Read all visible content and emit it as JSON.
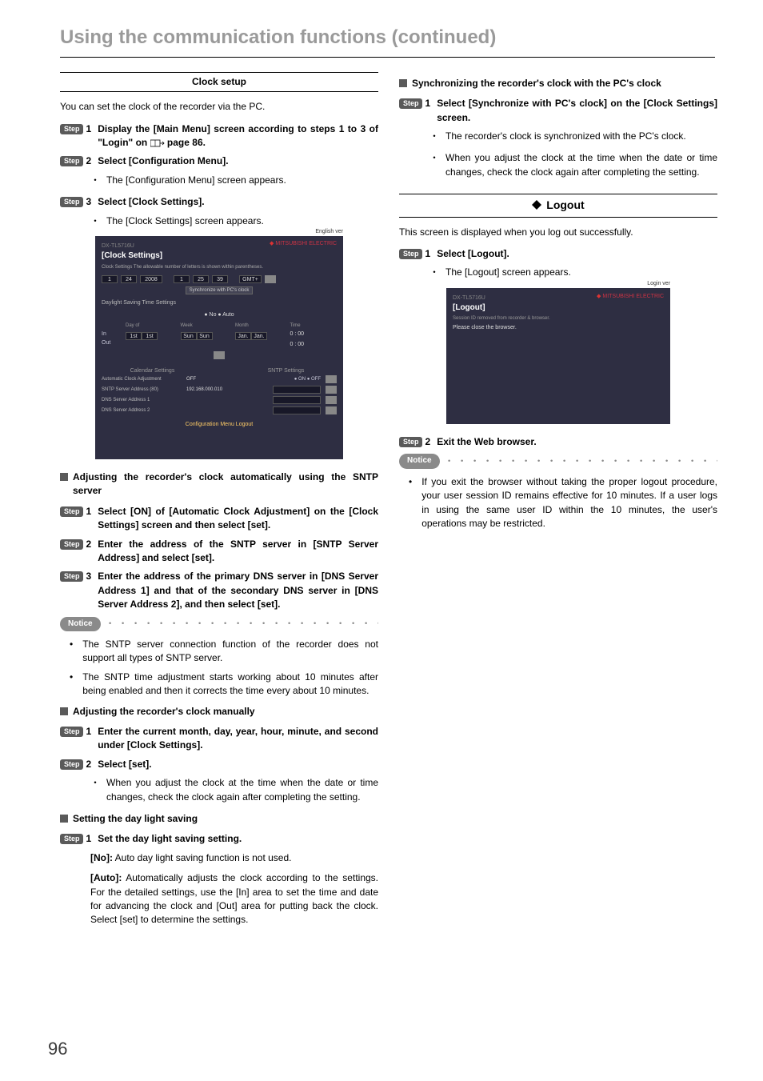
{
  "chapterTitle": "Using the communication functions (continued)",
  "left": {
    "sectionTitle": "Clock setup",
    "intro": "You can set the clock of the recorder via the PC.",
    "stepLabel": "Step",
    "step1": "Display the [Main Menu] screen according to steps 1 to 3 of \"Login\" on",
    "step1pageRef": "page 86.",
    "step2": "Select [Configuration Menu].",
    "step2sub": "The [Configuration Menu] screen appears.",
    "step3": "Select [Clock Settings].",
    "step3sub": "The [Clock Settings] screen appears.",
    "shot1": {
      "model": "DX-TL5716U",
      "english": "English ver",
      "title": "[Clock Settings]",
      "brand": "MITSUBISHI ELECTRIC",
      "noteline": "Clock Settings   The allowable number of letters is shown within parentheses.",
      "fields": {
        "month": "1",
        "day": "24",
        "year": "2008",
        "hour": "1",
        "min": "25",
        "sec": "39",
        "tz": "GMT+"
      },
      "syncBtn": "Synchronize with PC's clock",
      "dst": "Daylight Saving Time Settings",
      "radios": "● No ● Auto",
      "tbl": {
        "cols": [
          "Day of",
          "Week",
          "Month",
          "Time"
        ],
        "rows": [
          {
            "label": "In",
            "vals": [
              "1st",
              "Sun",
              "Jan.",
              "0 : 00"
            ]
          },
          {
            "label": "Out",
            "vals": [
              "1st",
              "Sun",
              "Jan.",
              "0 : 00"
            ]
          }
        ]
      },
      "calHead1": "Calendar Settings",
      "calHead2": "SNTP Settings",
      "rows": [
        {
          "l": "Automatic Clock Adjustment",
          "v": "OFF",
          "r": "● ON ● OFF"
        },
        {
          "l": "SNTP Server Address (80)",
          "v": "192.168.000.010",
          "r": ""
        },
        {
          "l": "DNS Server Address 1",
          "v": "",
          "r": ""
        },
        {
          "l": "DNS Server Address 2",
          "v": "",
          "r": ""
        }
      ],
      "foot": "Configuration Menu  Logout"
    },
    "headingAuto": "Adjusting the recorder's clock automatically using the SNTP server",
    "auto1": "Select [ON] of [Automatic Clock Adjustment] on the [Clock Settings] screen and then select [set].",
    "auto2": "Enter the address of the SNTP server in [SNTP Server Address] and select [set].",
    "auto3": "Enter the address of the primary DNS server in [DNS Server Address 1] and that of the secondary DNS server in [DNS Server Address 2], and then select [set].",
    "noticeLabel": "Notice",
    "noticeItems": [
      "The SNTP server connection function of the recorder does not support all types of SNTP server.",
      "The SNTP time adjustment starts working about 10 minutes after being enabled and then it corrects the time every about 10 minutes."
    ],
    "headingManual": "Adjusting the recorder's clock manually",
    "man1": "Enter the current month, day, year, hour, minute, and second under [Clock Settings].",
    "man2": "Select [set].",
    "man2sub": "When you adjust the clock at the time when the date or time changes, check the clock again after completing the setting.",
    "headingDST": "Setting the day light saving",
    "dst1": "Set the day light saving setting.",
    "dstNoLabel": "[No]:",
    "dstNo": "Auto day light saving function is not used.",
    "dstAutoLabel": "[Auto]:",
    "dstAuto": "Automatically adjusts the clock according to the settings. For the detailed settings, use the [In] area to set the time and date for advancing the clock and [Out] area for putting back the clock. Select [set] to determine the settings."
  },
  "right": {
    "headingSync": "Synchronizing the recorder's clock with the PC's clock",
    "stepLabel": "Step",
    "sync1": "Select [Synchronize with PC's clock] on the [Clock Settings] screen.",
    "sync1a": "The recorder's clock is synchronized with the PC's clock.",
    "sync1b": "When you adjust the clock at the time when the date or time changes, check the clock again after completing the setting.",
    "logoutTitle": "Logout",
    "logoutIntro": "This screen is displayed when you log out successfully.",
    "logout1": "Select [Logout].",
    "logout1sub": "The [Logout] screen appears.",
    "shot2": {
      "model": "DX-TL5716U",
      "english": "Login ver",
      "title": "[Logout]",
      "brand": "MITSUBISHI ELECTRIC",
      "msg1": "Session ID removed from recorder & browser.",
      "msg2": "Please close the browser."
    },
    "logout2": "Exit the Web browser.",
    "noticeLabel": "Notice",
    "noticeText": "If you exit the browser without taking the proper logout procedure, your user session ID remains effective for 10 minutes. If a user logs in using the same user ID within the 10 minutes, the user's operations may be restricted."
  },
  "pageNumber": "96"
}
